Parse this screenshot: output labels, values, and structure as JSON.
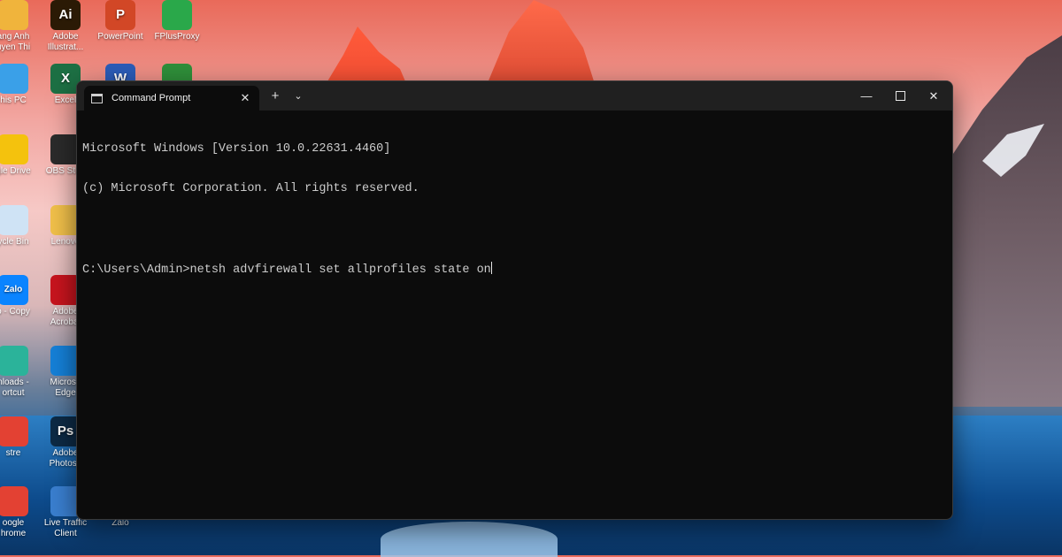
{
  "desktop": {
    "icons": [
      {
        "label": "ang Anh\nuyen Thi",
        "icon": "user-folder-icon",
        "color": "#f0b43c"
      },
      {
        "label": "Adobe\nIllustrat...",
        "icon": "adobe-illustrator-icon",
        "color": "#2b1a05"
      },
      {
        "label": "PowerPoint",
        "icon": "powerpoint-icon",
        "color": "#d24726"
      },
      {
        "label": "FPlusProxy",
        "icon": "fplusproxy-icon",
        "color": "#2aa84a"
      },
      {
        "label": "his PC",
        "icon": "this-pc-icon",
        "color": "#3aa0e8"
      },
      {
        "label": "Excel",
        "icon": "excel-icon",
        "color": "#1d7044"
      },
      {
        "label": "",
        "icon": "word-icon",
        "color": "#2b5cb8"
      },
      {
        "label": "",
        "icon": "app-green-icon",
        "color": "#2f8f3a"
      },
      {
        "label": "gle Drive",
        "icon": "google-drive-icon",
        "color": "#f4c20d"
      },
      {
        "label": "OBS Stud",
        "icon": "obs-studio-icon",
        "color": "#2b2b2b"
      },
      {
        "label": "ycle Bin",
        "icon": "recycle-bin-icon",
        "color": "#cfe3f5"
      },
      {
        "label": "Lenovo",
        "icon": "folder-icon",
        "color": "#f1c04a"
      },
      {
        "label": "o - Copy",
        "icon": "zalo-icon",
        "color": "#0a84ff"
      },
      {
        "label": "Adobe\nAcrobat",
        "icon": "adobe-acrobat-icon",
        "color": "#c8141e"
      },
      {
        "label": "nloads -\nortcut",
        "icon": "downloads-icon",
        "color": "#2bb39a"
      },
      {
        "label": "Microso\nEdge",
        "icon": "edge-icon",
        "color": "#1580d8"
      },
      {
        "label": "stre",
        "icon": "chrome-profile-icon",
        "color": "#e34133"
      },
      {
        "label": "Adobe\nPhotosh",
        "icon": "photoshop-icon",
        "color": "#0d2a45"
      },
      {
        "label": "oogle\nhrome",
        "icon": "chrome-icon",
        "color": "#e34133"
      },
      {
        "label": "Live Traffic\nClient",
        "icon": "live-traffic-icon",
        "color": "#3a7fd0"
      },
      {
        "label": "Zalo",
        "icon": "",
        "color": ""
      }
    ],
    "icon_glyphs": {
      "adobe-illustrator-icon": "Ai",
      "powerpoint-icon": "P",
      "excel-icon": "X",
      "word-icon": "W",
      "photoshop-icon": "Ps",
      "zalo-icon": "Zalo"
    }
  },
  "window": {
    "tab_title": "Command Prompt",
    "new_tab_symbol": "+",
    "dropdown_symbol": "⌄",
    "close_tab_symbol": "✕",
    "minimize_symbol": "—",
    "close_window_symbol": "✕",
    "console_lines": [
      "Microsoft Windows [Version 10.0.22631.4460]",
      "(c) Microsoft Corporation. All rights reserved.",
      "",
      "C:\\Users\\Admin>netsh advfirewall set allprofiles state on"
    ]
  }
}
